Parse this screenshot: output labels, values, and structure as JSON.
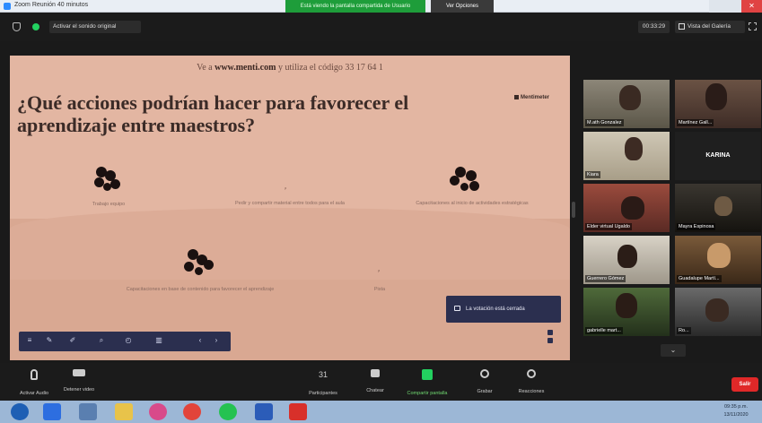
{
  "window": {
    "title": "Zoom Reunión 40 minutos",
    "share_banner": "Está viendo la pantalla compartida de Usuario",
    "stop_share_label": "Ver Opciones",
    "close_label": "✕"
  },
  "topbar": {
    "zoom_select": "Activar el sonido original",
    "timer": "00:33:29",
    "view_label": "Vista del Galería"
  },
  "slide": {
    "instructions_prefix": "Ve a",
    "instructions_site": "www.menti.com",
    "instructions_suffix": "y utiliza el código 33 17 64 1",
    "question": "¿Qué acciones podrían hacer para favorecer el aprendizaje entre maestros?",
    "brand": "Mentimeter",
    "responses": [
      "Trabajo equipo",
      "Pedir y compartir material entre todos para el aula",
      "Capacitaciones al inicio de actividades estratégicas",
      "Capacitaciones en base de contenido para favorecer el aprendizaje",
      "Pista"
    ],
    "present_button": "La votación está cerrada",
    "toolbar_icons": [
      "menu-icon",
      "pencil-icon",
      "pen-icon",
      "search-icon",
      "timer-icon",
      "chart-icon",
      "prev-icon",
      "next-icon"
    ]
  },
  "participants": [
    {
      "name": "M.ath Gonzalez"
    },
    {
      "name": "Martínez Gall..."
    },
    {
      "name": "Kiara"
    },
    {
      "name": "KARINA"
    },
    {
      "name": "Elder virtual Ugaldo"
    },
    {
      "name": "Mayra Espinosa"
    },
    {
      "name": "Guerrero Gómez"
    },
    {
      "name": "Guadalupe Martí..."
    },
    {
      "name": "gabrielle mart..."
    },
    {
      "name": "Ro..."
    }
  ],
  "bottombar": {
    "mute": "Activar Audio",
    "video": "Detener video",
    "participants": "Participantes",
    "participants_count": "31",
    "chat": "Chatear",
    "share": "Compartir pantalla",
    "record": "Grabar",
    "reactions": "Reacciones",
    "end": "Salir"
  },
  "taskbar": {
    "time": "09:35 p.m.",
    "date": "13/11/2020"
  }
}
